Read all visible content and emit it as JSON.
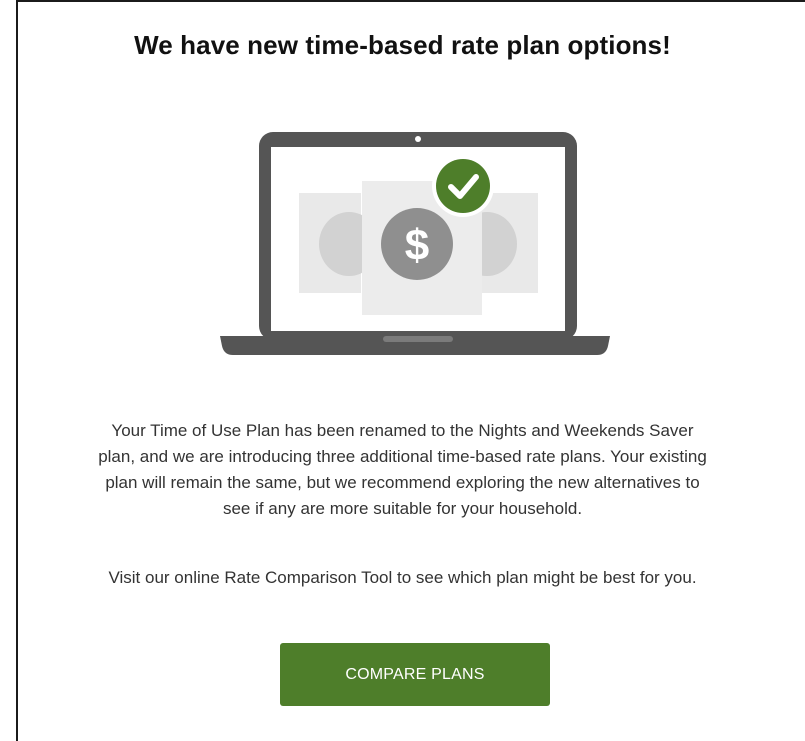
{
  "heading": "We have new time-based rate plan options!",
  "body": {
    "paragraph1_lines": [
      "Your Time of Use Plan has been renamed to the Nights and Weekends Saver",
      "plan, and we are introducing three additional time-based rate plans. Your existing",
      "plan will remain the same, but we recommend exploring the new alternatives to",
      "see if any are more suitable for your household."
    ],
    "paragraph2": "Visit our online Rate Comparison Tool to see which plan might be best for you."
  },
  "cta": {
    "label": "COMPARE PLANS"
  },
  "illustration": {
    "laptop_icon": "laptop-icon",
    "dollar_icon": "dollar-sign-icon",
    "check_icon": "checkmark-icon",
    "symbol_dollar": "$"
  },
  "colors": {
    "accent_green": "#4e7e2a",
    "laptop_gray": "#555555",
    "coin_gray": "#8f8f8f"
  }
}
